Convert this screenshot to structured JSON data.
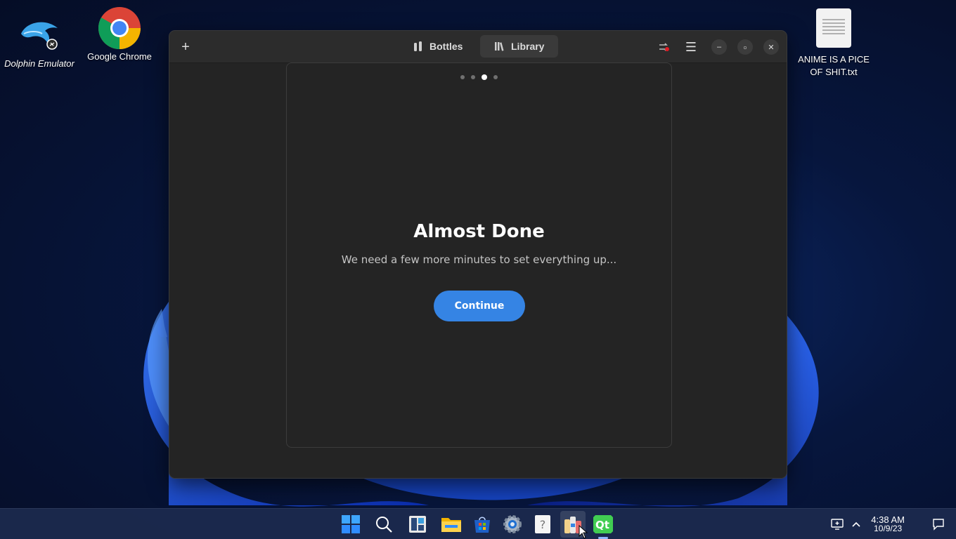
{
  "desktop": {
    "icons": [
      {
        "label": "Dolphin Emulator"
      },
      {
        "label": "Google Chrome"
      },
      {
        "label": "ANIME IS A PICE OF SHIT.txt"
      }
    ]
  },
  "window": {
    "tabs": [
      {
        "label": "Bottles",
        "icon": "bottles-icon"
      },
      {
        "label": "Library",
        "icon": "library-icon"
      }
    ],
    "active_tab": "Library",
    "add_glyph": "+",
    "menu_glyph": "☰",
    "minimize_glyph": "–",
    "maximize_glyph": "▫",
    "close_glyph": "✕"
  },
  "dialog": {
    "page_dots": 4,
    "active_dot": 3,
    "title": "Almost Done",
    "subtitle": "We need a few more minutes to set everything up...",
    "continue_label": "Continue"
  },
  "taskbar": {
    "apps": [
      "start",
      "search",
      "widgets",
      "file-explorer",
      "store",
      "settings",
      "help",
      "bottles",
      "qt"
    ],
    "time": "4:38 AM",
    "date": "10/9/23"
  },
  "colors": {
    "accent": "#3584e4",
    "window_bg": "#242424",
    "headerbar_bg": "#2c2c2c"
  }
}
